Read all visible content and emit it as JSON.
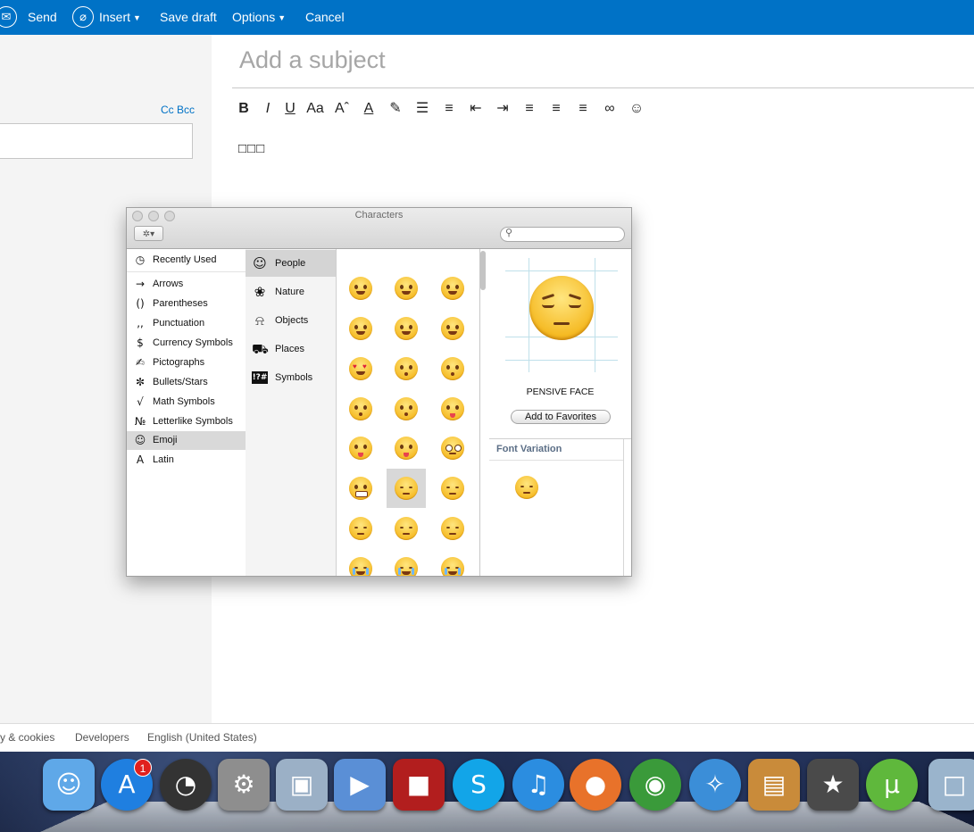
{
  "toolbar": {
    "send": "Send",
    "insert": "Insert",
    "save_draft": "Save draft",
    "options": "Options",
    "cancel": "Cancel"
  },
  "compose": {
    "cc_bcc": "Cc Bcc",
    "subject_placeholder": "Add a subject",
    "body_text": "□□□"
  },
  "format_toolbar": [
    {
      "icon": "bold-icon",
      "glyph": "B"
    },
    {
      "icon": "italic-icon",
      "glyph": "I"
    },
    {
      "icon": "underline-icon",
      "glyph": "U"
    },
    {
      "icon": "font-icon",
      "glyph": "Aa"
    },
    {
      "icon": "font-size-icon",
      "glyph": "Aˆ"
    },
    {
      "icon": "font-color-icon",
      "glyph": "A"
    },
    {
      "icon": "highlight-icon",
      "glyph": "✎"
    },
    {
      "icon": "numbered-list-icon",
      "glyph": "☰"
    },
    {
      "icon": "bullet-list-icon",
      "glyph": "≡"
    },
    {
      "icon": "decrease-indent-icon",
      "glyph": "⇤"
    },
    {
      "icon": "increase-indent-icon",
      "glyph": "⇥"
    },
    {
      "icon": "align-left-icon",
      "glyph": "≡"
    },
    {
      "icon": "align-center-icon",
      "glyph": "≡"
    },
    {
      "icon": "align-right-icon",
      "glyph": "≡"
    },
    {
      "icon": "link-icon",
      "glyph": "∞"
    },
    {
      "icon": "emoji-icon",
      "glyph": "☺"
    }
  ],
  "footer": {
    "privacy": "y & cookies",
    "developers": "Developers",
    "language": "English (United States)"
  },
  "characters_window": {
    "title": "Characters",
    "categories": [
      {
        "icon": "clock-icon",
        "glyph": "◷",
        "label": "Recently Used"
      },
      {
        "icon": "arrow-icon",
        "glyph": "→",
        "label": "Arrows"
      },
      {
        "icon": "parentheses-icon",
        "glyph": "()",
        "label": "Parentheses"
      },
      {
        "icon": "punctuation-icon",
        "glyph": "‚,",
        "label": "Punctuation"
      },
      {
        "icon": "dollar-icon",
        "glyph": "$",
        "label": "Currency Symbols"
      },
      {
        "icon": "pictograph-icon",
        "glyph": "✍",
        "label": "Pictographs"
      },
      {
        "icon": "asterisk-icon",
        "glyph": "✼",
        "label": "Bullets/Stars"
      },
      {
        "icon": "sqrt-icon",
        "glyph": "√",
        "label": "Math Symbols"
      },
      {
        "icon": "numero-icon",
        "glyph": "№",
        "label": "Letterlike Symbols"
      },
      {
        "icon": "smiley-icon",
        "glyph": "☺",
        "label": "Emoji"
      },
      {
        "icon": "latin-a-icon",
        "glyph": "A",
        "label": "Latin"
      }
    ],
    "selected_category": "Emoji",
    "subcategories": [
      {
        "icon": "smiley-face-icon",
        "glyph": "☺",
        "label": "People"
      },
      {
        "icon": "flower-icon",
        "glyph": "❀",
        "label": "Nature"
      },
      {
        "icon": "bell-icon",
        "glyph": "⍾",
        "label": "Objects"
      },
      {
        "icon": "car-icon",
        "glyph": "⛟",
        "label": "Places"
      },
      {
        "icon": "symbols-icon",
        "glyph": "!?#",
        "label": "Symbols"
      }
    ],
    "selected_subcategory": "People",
    "selected_character": "PENSIVE FACE",
    "add_to_favorites": "Add to Favorites",
    "font_variation": "Font Variation"
  },
  "dock": {
    "app_store_badge": "1",
    "apps": [
      {
        "icon": "finder-icon",
        "glyph": "☺",
        "color": "#5fa8e8"
      },
      {
        "icon": "app-store-icon",
        "glyph": "A",
        "color": "#1f7fe0"
      },
      {
        "icon": "dashboard-icon",
        "glyph": "◔",
        "color": "#333333"
      },
      {
        "icon": "system-preferences-icon",
        "glyph": "⚙",
        "color": "#8e8e8e"
      },
      {
        "icon": "preview-icon",
        "glyph": "▣",
        "color": "#9bb0c6"
      },
      {
        "icon": "imovie-icon",
        "glyph": "▶",
        "color": "#5a8fd6"
      },
      {
        "icon": "photo-booth-icon",
        "glyph": "■",
        "color": "#b21e1e"
      },
      {
        "icon": "skype-icon",
        "glyph": "S",
        "color": "#12a5e8"
      },
      {
        "icon": "itunes-icon",
        "glyph": "♫",
        "color": "#2b8de0"
      },
      {
        "icon": "firefox-icon",
        "glyph": "●",
        "color": "#e8722a"
      },
      {
        "icon": "chrome-icon",
        "glyph": "◉",
        "color": "#3a9a3a"
      },
      {
        "icon": "safari-icon",
        "glyph": "✧",
        "color": "#3b8ed8"
      },
      {
        "icon": "iphoto-icon",
        "glyph": "▤",
        "color": "#c98b3a"
      },
      {
        "icon": "imovie-star-icon",
        "glyph": "★",
        "color": "#4a4a4a"
      },
      {
        "icon": "utorrent-icon",
        "glyph": "µ",
        "color": "#5fb83c"
      },
      {
        "icon": "folder-icon",
        "glyph": "□",
        "color": "#9ab4cc"
      }
    ]
  }
}
